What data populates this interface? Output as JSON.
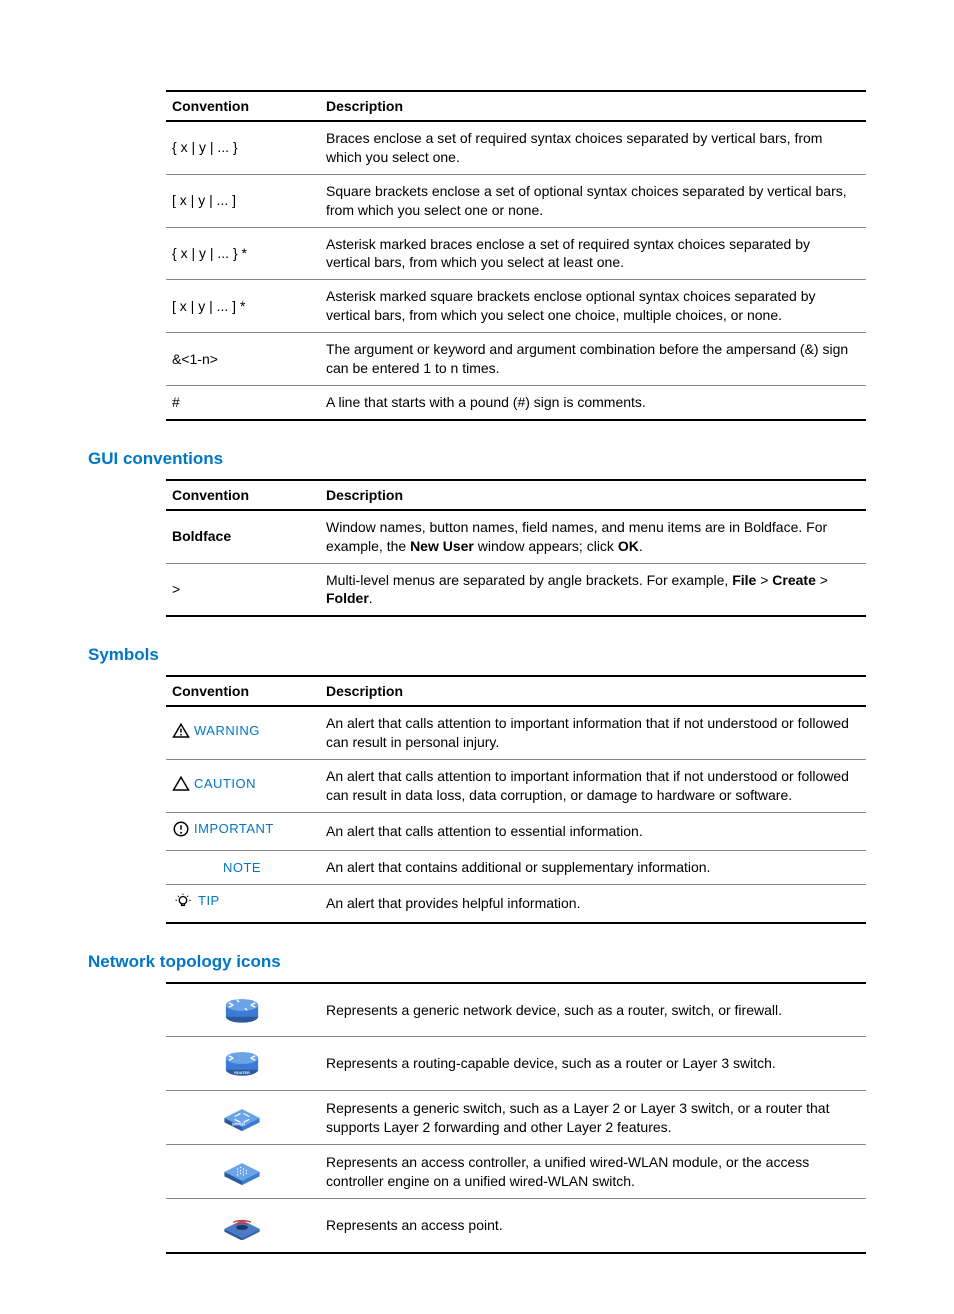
{
  "tables": {
    "syntax": {
      "headers": [
        "Convention",
        "Description"
      ],
      "rows": [
        {
          "conv": "{ x | y | ... }",
          "desc": "Braces enclose a set of required syntax choices separated by vertical bars, from which you select one."
        },
        {
          "conv": "[ x | y | ... ]",
          "desc": "Square brackets enclose a set of optional syntax choices separated by vertical bars, from which you select one or none."
        },
        {
          "conv": "{ x | y | ... } *",
          "desc": "Asterisk marked braces enclose a set of required syntax choices separated by vertical bars, from which you select at least one."
        },
        {
          "conv": "[ x | y | ... ] *",
          "desc": "Asterisk marked square brackets enclose optional syntax choices separated by vertical bars, from which you select one choice, multiple choices, or none."
        },
        {
          "conv": "&<1-n>",
          "desc": "The argument or keyword and argument combination before the ampersand (&) sign can be entered 1 to n times."
        },
        {
          "conv": "#",
          "desc": "A line that starts with a pound (#) sign is comments."
        }
      ]
    },
    "gui": {
      "title": "GUI conventions",
      "headers": [
        "Convention",
        "Description"
      ],
      "rows": [
        {
          "conv": "Boldface",
          "desc_pre": "Window names, button names, field names, and menu items are in Boldface. For example, the ",
          "bold1": "New User",
          "mid": " window appears; click ",
          "bold2": "OK",
          "post": "."
        },
        {
          "conv": ">",
          "desc_pre": "Multi-level menus are separated by angle brackets. For example, ",
          "b1": "File",
          "s1": " > ",
          "b2": "Create",
          "s2": " > ",
          "b3": "Folder",
          "post": "."
        }
      ]
    },
    "symbols": {
      "title": "Symbols",
      "headers": [
        "Convention",
        "Description"
      ],
      "rows": [
        {
          "label": "WARNING",
          "desc": "An alert that calls attention to important information that if not understood or followed can result in personal injury."
        },
        {
          "label": "CAUTION",
          "desc": "An alert that calls attention to important information that if not understood or followed can result in data loss, data corruption, or damage to hardware or software."
        },
        {
          "label": "IMPORTANT",
          "desc": "An alert that calls attention to essential information."
        },
        {
          "label": "NOTE",
          "desc": "An alert that contains additional or supplementary information."
        },
        {
          "label": "TIP",
          "desc": "An alert that provides helpful information."
        }
      ]
    },
    "network": {
      "title": "Network topology icons",
      "rows": [
        {
          "desc": "Represents a generic network device, such as a router, switch, or firewall."
        },
        {
          "desc": "Represents a routing-capable device, such as a router or Layer 3 switch."
        },
        {
          "desc": "Represents a generic switch, such as a Layer 2 or Layer 3 switch, or a router that supports Layer 2 forwarding and other Layer 2 features."
        },
        {
          "desc": "Represents an access controller, a unified wired-WLAN module, or the access controller engine on a unified wired-WLAN switch."
        },
        {
          "desc": "Represents an access point."
        }
      ]
    }
  }
}
